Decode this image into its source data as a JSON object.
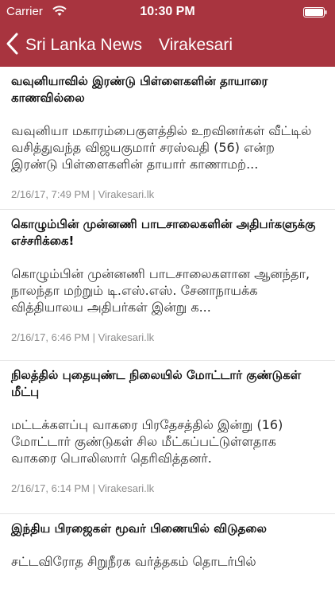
{
  "status": {
    "carrier": "Carrier",
    "time": "10:30 PM"
  },
  "nav": {
    "back_label": "Sri Lanka News",
    "title": "Virakesari"
  },
  "theme": {
    "bar_color": "#a8343f"
  },
  "articles": [
    {
      "headline": "வவுனியாவில் இரண்டு பிள்ளைகளின் தாயாரை காணவில்லை",
      "summary": "வவுனியா மகாரம்பைகுளத்தில் உறவினர்கள் வீட்டில் வசித்துவந்த விஜயகுமார் சரஸ்வதி (56) என்ற இரண்டு பிள்ளைகளின் தாயார் காணாமற்...",
      "meta": "2/16/17, 7:49 PM | Virakesari.lk"
    },
    {
      "headline": "கொழும்பின் முன்னணி பாடசாலைகளின் அதிபர்களுக்கு எச்சரிக்கை!",
      "summary": "கொழும்பின் முன்னணி பாடசாலைகளான ஆனந்தா, நாலந்தா மற்றும் டி.எஸ்.எஸ். சேனாநாயக்க வித்தியாலய அதிபர்கள் இன்று க...",
      "meta": "2/16/17, 6:46 PM | Virakesari.lk"
    },
    {
      "headline": "நிலத்தில் புதையுண்ட நிலையில் மோட்டார் குண்டுகள் மீட்பு",
      "summary": "மட்டக்களப்பு வாகரை பிரதேசத்தில் இன்று (16) மோட்டார் குண்டுகள் சில மீட்கப்பட்டுள்ளதாக வாகரை பொலிஸார் தெரிவித்தனர்.",
      "meta": "2/16/17, 6:14 PM | Virakesari.lk"
    },
    {
      "headline": "இந்திய பிரஜைகள் மூவர் பிணையில் விடுதலை",
      "summary": "சட்டவிரோத சிறுநீரக வர்த்தகம் தொடர்பில்"
    }
  ]
}
